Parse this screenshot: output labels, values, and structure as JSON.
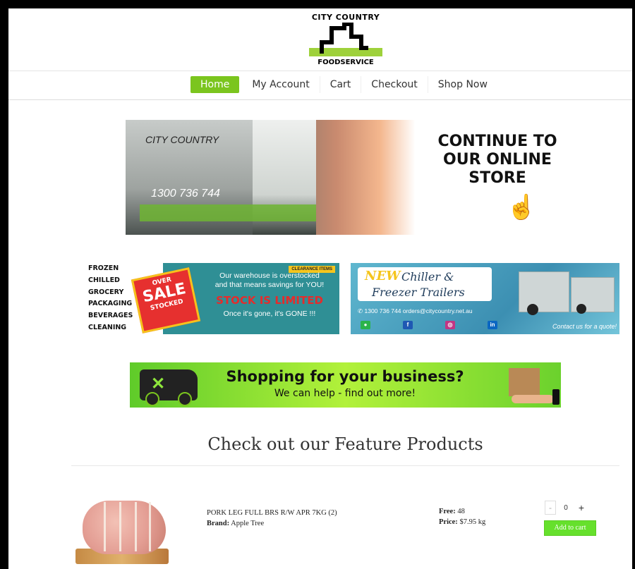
{
  "logo": {
    "top": "CITY COUNTRY",
    "bottom": "FOODSERVICE"
  },
  "nav": {
    "items": [
      "Home",
      "My Account",
      "Cart",
      "Checkout",
      "Shop Now"
    ],
    "active": "Home"
  },
  "hero": {
    "brand": "CITY COUNTRY",
    "phone": "1300 736 744",
    "cta_line1": "CONTINUE TO",
    "cta_line2": "OUR ONLINE",
    "cta_line3": "STORE"
  },
  "promo_left": {
    "categories": [
      "FROZEN",
      "CHILLED",
      "GROCERY",
      "PACKAGING",
      "BEVERAGES",
      "CLEANING"
    ],
    "badge": "CLEARANCE ITEMS",
    "sale_top": "OVER",
    "sale": "SALE",
    "sale_bottom": "STOCKED",
    "text_line1": "Our warehouse is overstocked",
    "text_line2": "and that means savings for YOU!",
    "limited": "STOCK IS LIMITED",
    "gone": "Once it's gone, it's GONE !!!"
  },
  "promo_right": {
    "new": "NEW",
    "title1": "Chiller &",
    "title2": "Freezer Trailers",
    "contact": "1300 736 744  orders@citycountry.net.au",
    "quote": "Contact us for a quote!"
  },
  "business": {
    "headline": "Shopping for your business?",
    "sub": "We can help - find out more!"
  },
  "featured": {
    "title": "Check out our Feature Products"
  },
  "product": {
    "name": "PORK LEG FULL BRS R/W APR 7KG (2)",
    "brand_label": "Brand:",
    "brand": "Apple Tree",
    "free_label": "Free:",
    "free": "48",
    "price_label": "Price:",
    "price": "$7.95  kg",
    "qty_minus": "-",
    "qty": "0",
    "qty_plus": "+",
    "add_label": "Add to cart"
  },
  "colors": {
    "accent": "#7bc51e",
    "add_button": "#66e02c"
  }
}
